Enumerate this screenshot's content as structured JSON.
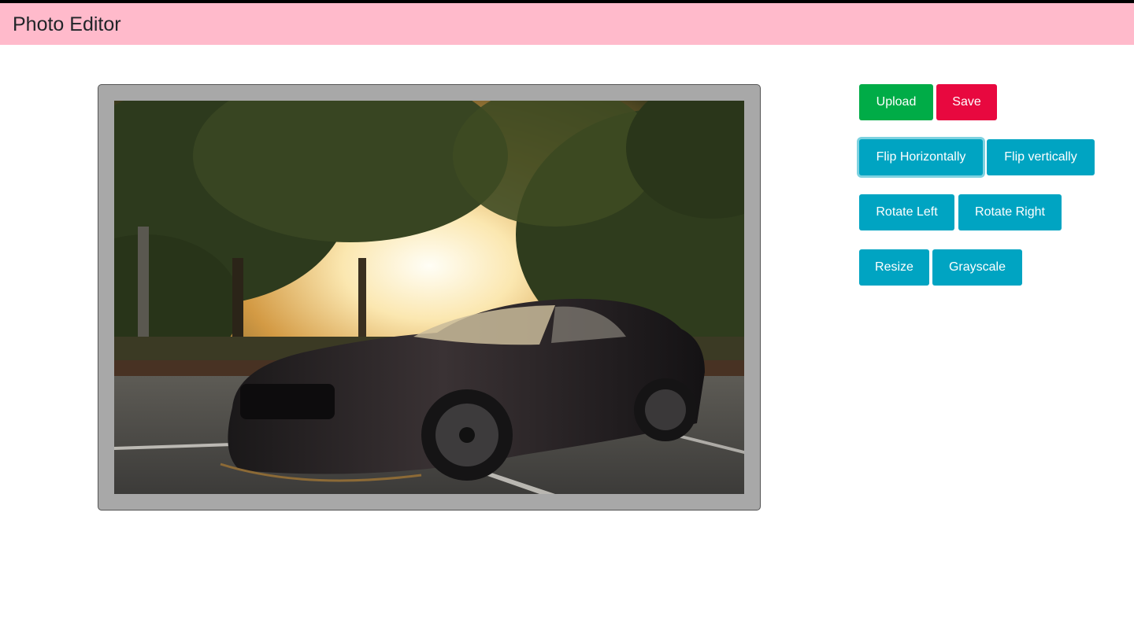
{
  "header": {
    "title": "Photo Editor"
  },
  "image": {
    "alt": "Black muscle car parked in a lot under trees at sunset"
  },
  "toolbar": {
    "upload": "Upload",
    "save": "Save",
    "flip_horizontal": "Flip Horizontally",
    "flip_vertical": "Flip vertically",
    "rotate_left": "Rotate Left",
    "rotate_right": "Rotate Right",
    "resize": "Resize",
    "grayscale": "Grayscale"
  },
  "colors": {
    "header_bg": "#ffbacb",
    "upload": "#00ac47",
    "save": "#e8083f",
    "tools": "#00a4c2"
  }
}
